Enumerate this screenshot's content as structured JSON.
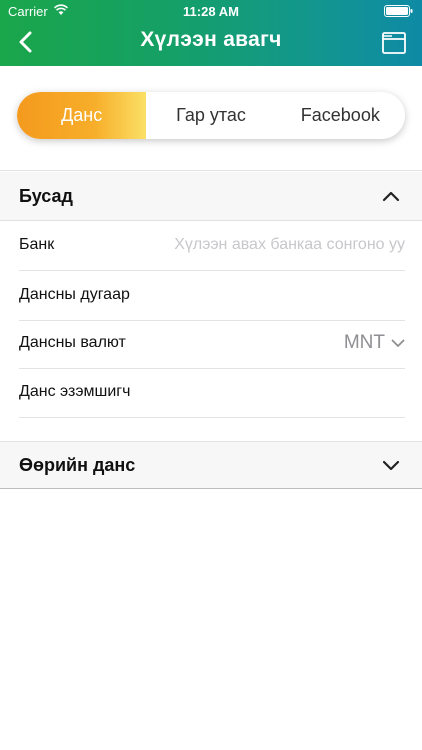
{
  "status_bar": {
    "carrier": "Carrier",
    "time": "11:28 AM"
  },
  "header": {
    "title": "Хүлээн авагч",
    "back_icon": "chevron-left-icon",
    "right_icon": "folder-icon"
  },
  "segments": [
    {
      "label": "Данс",
      "active": true
    },
    {
      "label": "Гар утас",
      "active": false
    },
    {
      "label": "Facebook",
      "active": false
    }
  ],
  "sections": {
    "other": {
      "title": "Бусад",
      "expanded": true,
      "fields": [
        {
          "label": "Банк",
          "placeholder": "Хүлээн авах банкаа сонгоно уу"
        },
        {
          "label": "Дансны дугаар",
          "value": ""
        },
        {
          "label": "Дансны валют",
          "value": "MNT"
        },
        {
          "label": "Данс эзэмшигч",
          "value": ""
        }
      ]
    },
    "own": {
      "title": "Өөрийн данс",
      "expanded": false
    }
  },
  "colors": {
    "header_start": "#1aa64a",
    "header_end": "#0f8aa6",
    "active_segment": "#f49a1e",
    "placeholder": "#c7c7cc"
  }
}
